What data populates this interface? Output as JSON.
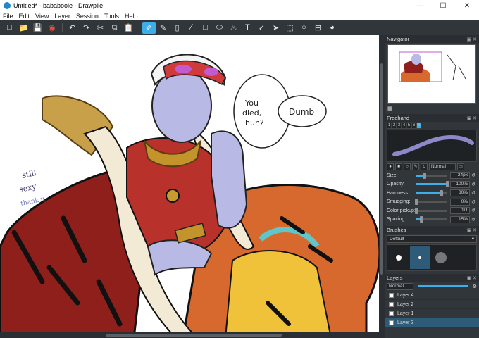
{
  "window": {
    "title": "Untitled* - bababooie - Drawpile"
  },
  "menu": [
    "File",
    "Edit",
    "View",
    "Layer",
    "Session",
    "Tools",
    "Help"
  ],
  "toolbar_icons": [
    "new-icon",
    "open-icon",
    "save-icon",
    "record-icon",
    "undo-icon",
    "redo-icon",
    "cut-icon",
    "copy-icon",
    "paste-icon",
    "brush-icon",
    "pen-icon",
    "eraser-icon",
    "line-icon",
    "rectangle-icon",
    "ellipse-icon",
    "fill-icon",
    "text-icon",
    "color-picker-icon",
    "select-icon",
    "lasso-icon",
    "laser-icon",
    "zoom-icon",
    "inspect-icon"
  ],
  "canvas_text": {
    "bubble1": "You\ndied,\nhuh?",
    "bubble2": "Dumb",
    "side_note1": "still",
    "side_note2": "sexy",
    "side_note3": "thank u"
  },
  "navigator": {
    "title": "Navigator"
  },
  "freehand": {
    "title": "Freehand",
    "presets": [
      "1",
      "2",
      "3",
      "4",
      "5",
      "6"
    ],
    "blend_mode": "Normal",
    "settings": [
      {
        "label": "Size:",
        "value": "24px",
        "fraction": 0.25
      },
      {
        "label": "Opacity:",
        "value": "100%",
        "fraction": 1.0
      },
      {
        "label": "Hardness:",
        "value": "80%",
        "fraction": 0.8
      },
      {
        "label": "Smudging:",
        "value": "0%",
        "fraction": 0.0
      },
      {
        "label": "Color pickup:",
        "value": "1/1",
        "fraction": 0.0
      },
      {
        "label": "Spacing:",
        "value": "15%",
        "fraction": 0.15
      }
    ]
  },
  "brushes": {
    "title": "Brushes",
    "preset": "Default"
  },
  "layers": {
    "title": "Layers",
    "blend_mode": "Normal",
    "items": [
      "Layer 4",
      "Layer 2",
      "Layer 1",
      "Layer 3"
    ],
    "selected": "Layer 3"
  },
  "colors": {
    "accent": "#3daee9",
    "panel": "#31363b",
    "selection": "#2e5c78"
  }
}
